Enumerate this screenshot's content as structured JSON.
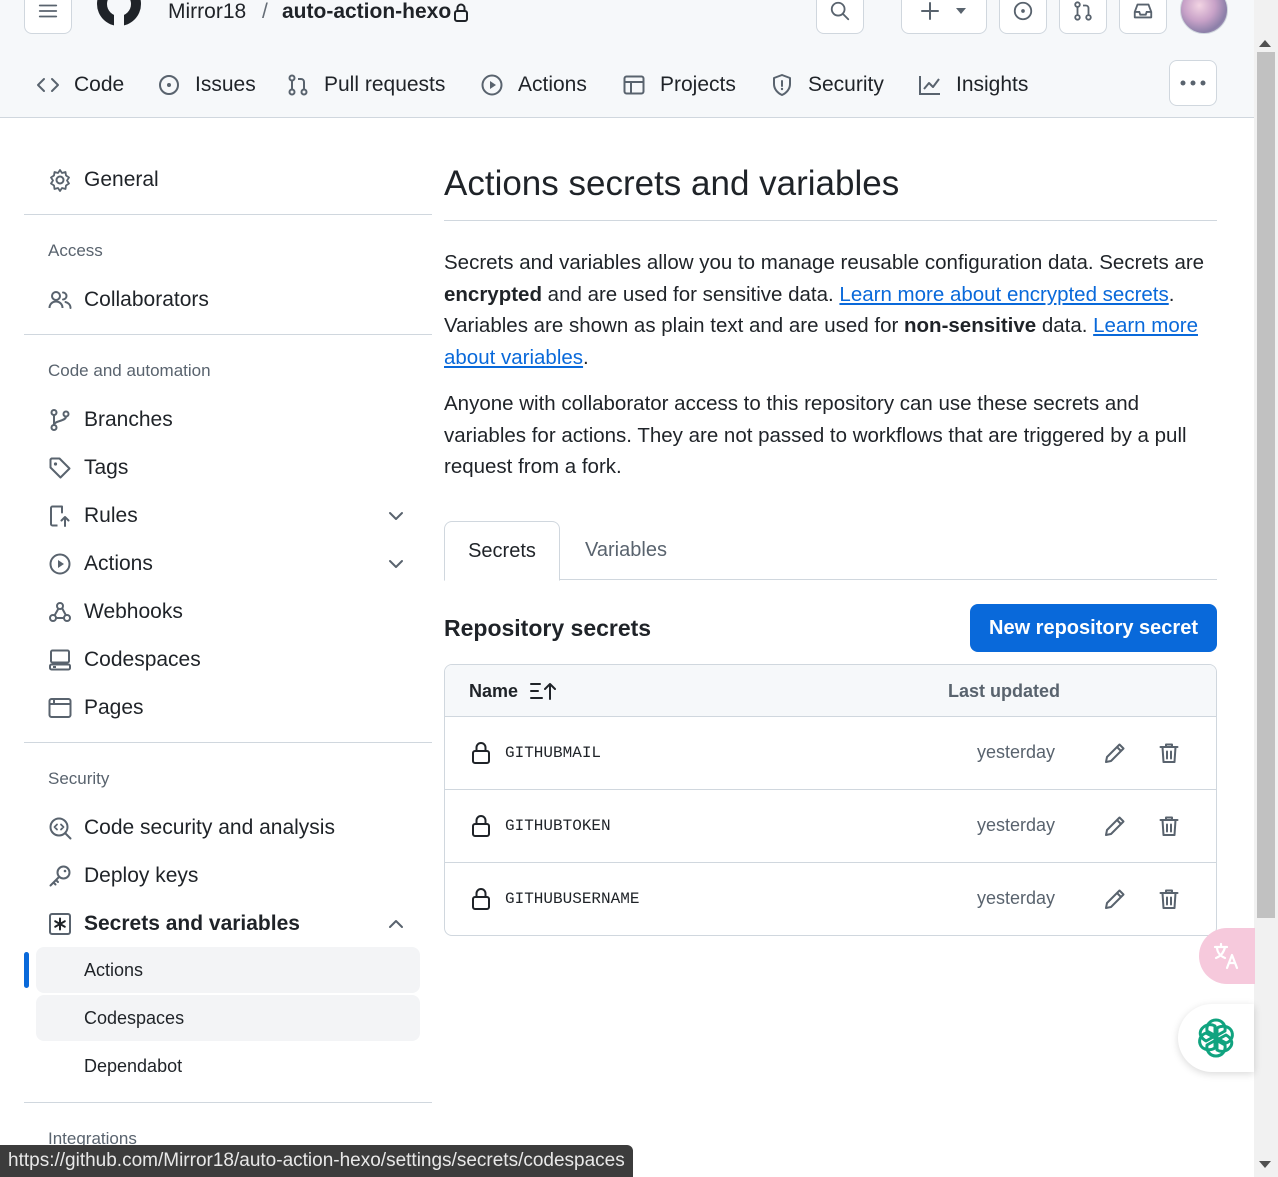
{
  "header": {
    "owner": "Mirror18",
    "separator": "/",
    "repo": "auto-action-hexo"
  },
  "repo_nav": [
    {
      "label": "Code",
      "icon": "code-icon"
    },
    {
      "label": "Issues",
      "icon": "issue-icon"
    },
    {
      "label": "Pull requests",
      "icon": "pull-request-icon"
    },
    {
      "label": "Actions",
      "icon": "play-icon"
    },
    {
      "label": "Projects",
      "icon": "table-icon"
    },
    {
      "label": "Security",
      "icon": "shield-icon"
    },
    {
      "label": "Insights",
      "icon": "graph-icon"
    }
  ],
  "sidebar": {
    "general": "General",
    "access_heading": "Access",
    "collaborators": "Collaborators",
    "code_heading": "Code and automation",
    "branches": "Branches",
    "tags": "Tags",
    "rules": "Rules",
    "actions": "Actions",
    "webhooks": "Webhooks",
    "codespaces": "Codespaces",
    "pages": "Pages",
    "security_heading": "Security",
    "code_security": "Code security and analysis",
    "deploy_keys": "Deploy keys",
    "secrets_vars": "Secrets and variables",
    "sub_actions": "Actions",
    "sub_codespaces": "Codespaces",
    "sub_dependabot": "Dependabot",
    "integrations_heading": "Integrations"
  },
  "main": {
    "title": "Actions secrets and variables",
    "p1_a": "Secrets and variables allow you to manage reusable configuration data. Secrets are ",
    "p1_b": "encrypted",
    "p1_c": " and are used for sensitive data. ",
    "p1_link1": "Learn more about encrypted secrets",
    "p1_d": ". Variables are shown as plain text and are used for ",
    "p1_e": "non-sensitive",
    "p1_f": " data. ",
    "p1_link2": "Learn more about variables",
    "p1_g": ".",
    "p2": "Anyone with collaborator access to this repository can use these secrets and variables for actions. They are not passed to workflows that are triggered by a pull request from a fork.",
    "tabs": [
      "Secrets",
      "Variables"
    ],
    "section_title": "Repository secrets",
    "new_button": "New repository secret",
    "table": {
      "col_name": "Name",
      "col_updated": "Last updated",
      "rows": [
        {
          "name": "GITHUBMAIL",
          "updated": "yesterday"
        },
        {
          "name": "GITHUBTOKEN",
          "updated": "yesterday"
        },
        {
          "name": "GITHUBUSERNAME",
          "updated": "yesterday"
        }
      ]
    }
  },
  "status_url": "https://github.com/Mirror18/auto-action-hexo/settings/secrets/codespaces",
  "colors": {
    "accent": "#0969da",
    "border": "#d0d7de",
    "muted": "#59636e"
  }
}
